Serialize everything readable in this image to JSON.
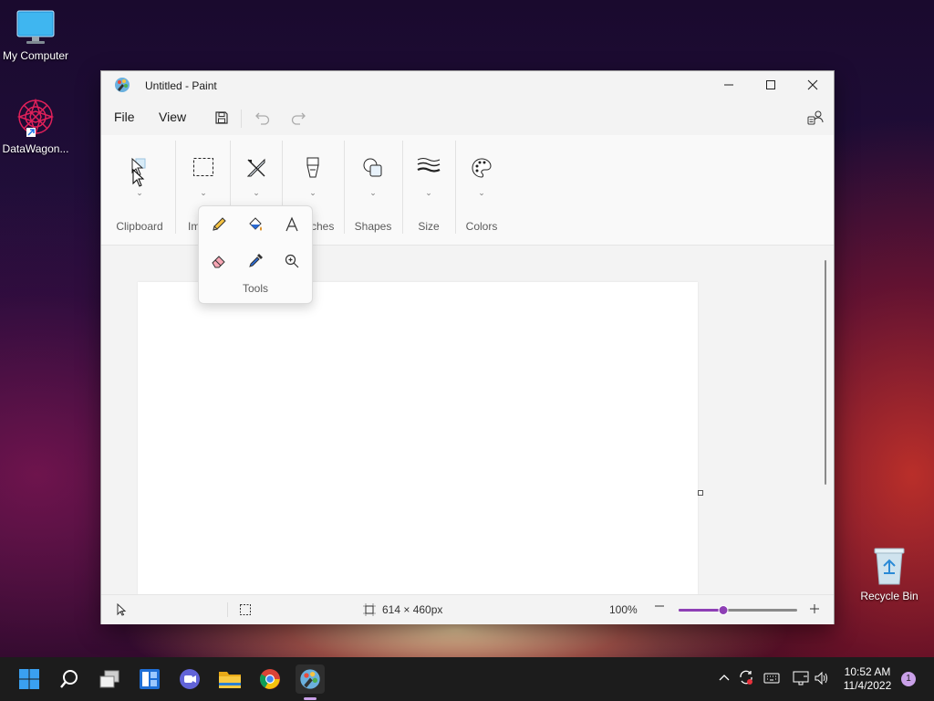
{
  "desktop": {
    "icons": [
      {
        "label": "My Computer"
      },
      {
        "label": "DataWagon..."
      },
      {
        "label": "Recycle Bin"
      }
    ]
  },
  "window": {
    "title": "Untitled - Paint",
    "menu": {
      "file": "File",
      "view": "View"
    },
    "ribbon": {
      "groups": [
        "Clipboard",
        "Im",
        "ches",
        "Shapes",
        "Size",
        "Colors"
      ]
    },
    "tools_popup": {
      "label": "Tools"
    },
    "status": {
      "canvas_size": "614 × 460px",
      "zoom": "100%",
      "zoom_fraction": 0.38
    }
  },
  "taskbar": {
    "clock_time": "10:52 AM",
    "clock_date": "11/4/2022",
    "notification_count": "1"
  },
  "colors": {
    "accent": "#8e3fb5",
    "taskbar": "#1c1c1c"
  }
}
